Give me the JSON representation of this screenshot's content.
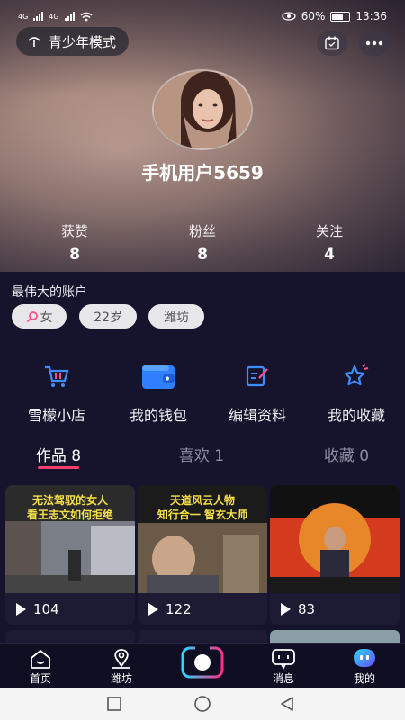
{
  "status_bar": {
    "left_text_1": "4G",
    "left_text_2": "4G",
    "battery_percent": "60%",
    "time": "13:36"
  },
  "header": {
    "teen_mode_label": "青少年模式"
  },
  "profile": {
    "username": "手机用户5659",
    "stats": [
      {
        "label": "获赞",
        "value": "8"
      },
      {
        "label": "粉丝",
        "value": "8"
      },
      {
        "label": "关注",
        "value": "4"
      }
    ],
    "signature": "最伟大的账户",
    "tags": [
      "女",
      "22岁",
      "潍坊"
    ]
  },
  "tools": [
    {
      "label": "雪檬小店",
      "icon": "cart-icon"
    },
    {
      "label": "我的钱包",
      "icon": "wallet-icon"
    },
    {
      "label": "编辑资料",
      "icon": "edit-icon"
    },
    {
      "label": "我的收藏",
      "icon": "star-icon"
    }
  ],
  "tabs": [
    {
      "label": "作品 8",
      "active": true
    },
    {
      "label": "喜欢 1",
      "active": false
    },
    {
      "label": "收藏 0",
      "active": false
    }
  ],
  "videos": [
    {
      "title_line1": "无法驾驭的女人",
      "title_line2": "看王志文如何拒绝",
      "plays": "104"
    },
    {
      "title_line1": "天道风云人物",
      "title_line2": "知行合一 智玄大师",
      "plays": "122"
    },
    {
      "title_line1": "",
      "title_line2": "",
      "plays": "83"
    }
  ],
  "bottom_nav": [
    {
      "label": "首页",
      "icon": "home-icon"
    },
    {
      "label": "潍坊",
      "icon": "location-person-icon"
    },
    {
      "label": "",
      "icon": "camera-icon"
    },
    {
      "label": "消息",
      "icon": "message-icon"
    },
    {
      "label": "我的",
      "icon": "me-icon"
    }
  ],
  "colors": {
    "accent": "#ff3d6b",
    "background": "#15142c",
    "icon_blue": "#3f8cff"
  }
}
